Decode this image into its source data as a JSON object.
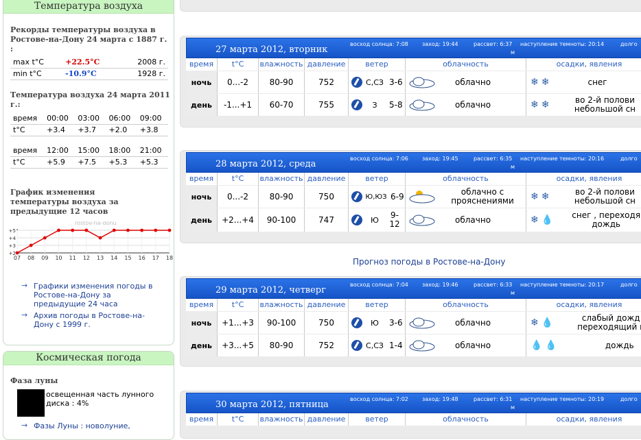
{
  "sidebar": {
    "panel1_title": "Температура воздуха",
    "records_heading": "Рекорды температуры воздуха в Ростове-на-Дону 24 марта с 1887 г. :",
    "records": [
      {
        "label": "max t°C",
        "value": "+22.5°C",
        "year": "2008 г."
      },
      {
        "label": "min t°C",
        "value": "-10.9°C",
        "year": "1928 г."
      }
    ],
    "today_heading": "Температура воздуха 24 марта 2011 г.:",
    "table1": {
      "time_label": "время",
      "times": [
        "00:00",
        "03:00",
        "06:00",
        "09:00"
      ],
      "t_label": "t°C",
      "values": [
        "+3.4",
        "+3.7",
        "+2.0",
        "+3.8"
      ]
    },
    "table2": {
      "time_label": "время",
      "times": [
        "12:00",
        "15:00",
        "18:00",
        "21:00"
      ],
      "t_label": "t°C",
      "values": [
        "+5.9",
        "+7.5",
        "+5.3",
        "+5.3"
      ]
    },
    "chart_heading": "График изменения температуры воздуха за предыдущие 12 часов",
    "chart_watermark": "rostov-na-donu",
    "links": [
      "Графики изменения погоды в Ростове-на-Дону за предыдущие 24 часа",
      "Архив погоды в Ростове-на-Дону с 1999 г."
    ],
    "panel2_title": "Космическая погода",
    "moon_heading": "Фаза луны",
    "moon_text": "освещенная часть лунного диска : 4%",
    "moon_link": "Фазы Луны : новолуние,"
  },
  "chart_data": {
    "type": "line",
    "x": [
      "07",
      "08",
      "09",
      "10",
      "11",
      "12",
      "13",
      "14",
      "15",
      "16",
      "17",
      "18"
    ],
    "y_ticks": [
      "+5",
      "+4",
      "+3",
      "+2"
    ],
    "values": [
      2,
      3,
      4,
      5,
      5,
      5,
      4,
      5,
      5,
      5,
      5,
      5
    ],
    "ylim": [
      2,
      5
    ],
    "color": "#e00000"
  },
  "colors": {
    "accent": "#1654c7",
    "panel_head": "#c8f5c0"
  },
  "forecast": {
    "columns": [
      "время",
      "t°C",
      "влажность",
      "давление",
      "ветер",
      "облачность",
      "осадки, явления"
    ],
    "days": [
      {
        "date": "27 марта 2012, вторник",
        "sunrise": "восход солнца: 7:08",
        "sunset": "заход: 19:44",
        "dawn": "рассвет: 6:37",
        "dawn_unit": "м",
        "dark": "наступление темноты: 20:14",
        "extra": "долго",
        "rows": [
          {
            "tod": "ночь",
            "t": "0...-2",
            "hum": "80-90",
            "press": "752",
            "wind_dir": "С,СЗ",
            "wind_speed": "3-6",
            "cloud": "облачно",
            "precip": "снег",
            "precip_icons": "❄❄"
          },
          {
            "tod": "день",
            "t": "-1...+1",
            "hum": "60-70",
            "press": "755",
            "wind_dir": "З",
            "wind_speed": "5-8",
            "cloud": "облачно",
            "precip": "во 2-й полови небольшой сн",
            "precip_icons": "❄❄"
          }
        ]
      },
      {
        "date": "28 марта 2012, среда",
        "sunrise": "восход солнца: 7:06",
        "sunset": "заход: 19:45",
        "dawn": "рассвет: 6:35",
        "dawn_unit": "м",
        "dark": "наступление темноты: 20:16",
        "extra": "долго",
        "rows": [
          {
            "tod": "ночь",
            "t": "0...-2",
            "hum": "80-90",
            "press": "750",
            "wind_dir": "Ю,ЮЗ",
            "wind_speed": "6-9",
            "cloud": "облачно с прояснениями",
            "precip": "во 2-й полови небольшой сн",
            "precip_icons": "❄❄"
          },
          {
            "tod": "день",
            "t": "+2...+4",
            "hum": "90-100",
            "press": "747",
            "wind_dir": "Ю",
            "wind_speed": "9-12",
            "cloud": "облачно",
            "precip": "снег , переходя дождь",
            "precip_icons": "❄💧"
          }
        ]
      },
      {
        "date": "29 марта 2012, четверг",
        "sunrise": "восход солнца: 7:04",
        "sunset": "заход: 19:46",
        "dawn": "рассвет: 6:33",
        "dawn_unit": "м",
        "dark": "наступление темноты: 20:17",
        "extra": "долго",
        "rows": [
          {
            "tod": "ночь",
            "t": "+1...+3",
            "hum": "90-100",
            "press": "750",
            "wind_dir": "Ю",
            "wind_speed": "3-6",
            "cloud": "облачно",
            "precip": "слабый дожд переходящий в",
            "precip_icons": "❄💧"
          },
          {
            "tod": "день",
            "t": "+3...+5",
            "hum": "80-90",
            "press": "752",
            "wind_dir": "С,СЗ",
            "wind_speed": "1-4",
            "cloud": "облачно",
            "precip": "дождь",
            "precip_icons": "💧💧"
          }
        ]
      },
      {
        "date": "30 марта 2012, пятница",
        "sunrise": "восход солнца: 7:02",
        "sunset": "заход: 19:48",
        "dawn": "рассвет: 6:31",
        "dawn_unit": "м",
        "dark": "наступление темноты: 20:19",
        "extra": "долго",
        "rows": []
      }
    ],
    "center_link": "Прогноз погоды в Ростове-на-Дону"
  }
}
